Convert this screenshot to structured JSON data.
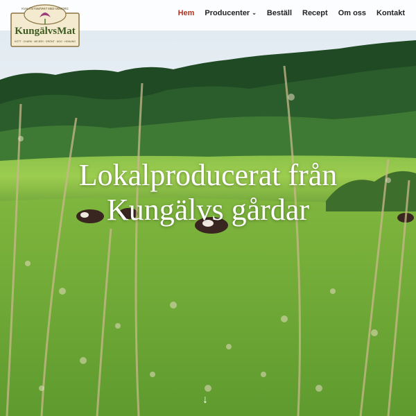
{
  "logo": {
    "arc_text": "KVALITETSMÄRKT MED OMSORG",
    "brand": "KungälvsMat",
    "tagline": "KÖTT · CHARK · MEJERI · GRÖNT · ÄGG · HONUNG"
  },
  "nav": {
    "items": [
      {
        "label": "Hem",
        "active": true
      },
      {
        "label": "Producenter",
        "has_dropdown": true
      },
      {
        "label": "Beställ"
      },
      {
        "label": "Recept"
      },
      {
        "label": "Om oss"
      },
      {
        "label": "Kontakt"
      }
    ],
    "dropdown_icon": "chevron-down-icon"
  },
  "hero": {
    "headline_line1": "Lokalproducerat från",
    "headline_line2": "Kungälvs gårdar",
    "scroll_icon": "arrow-down-icon",
    "scroll_glyph": "↓"
  },
  "colors": {
    "active_nav": "#b3341f",
    "logo_bg": "#f3ead0",
    "logo_brand": "#3d5a1f"
  }
}
